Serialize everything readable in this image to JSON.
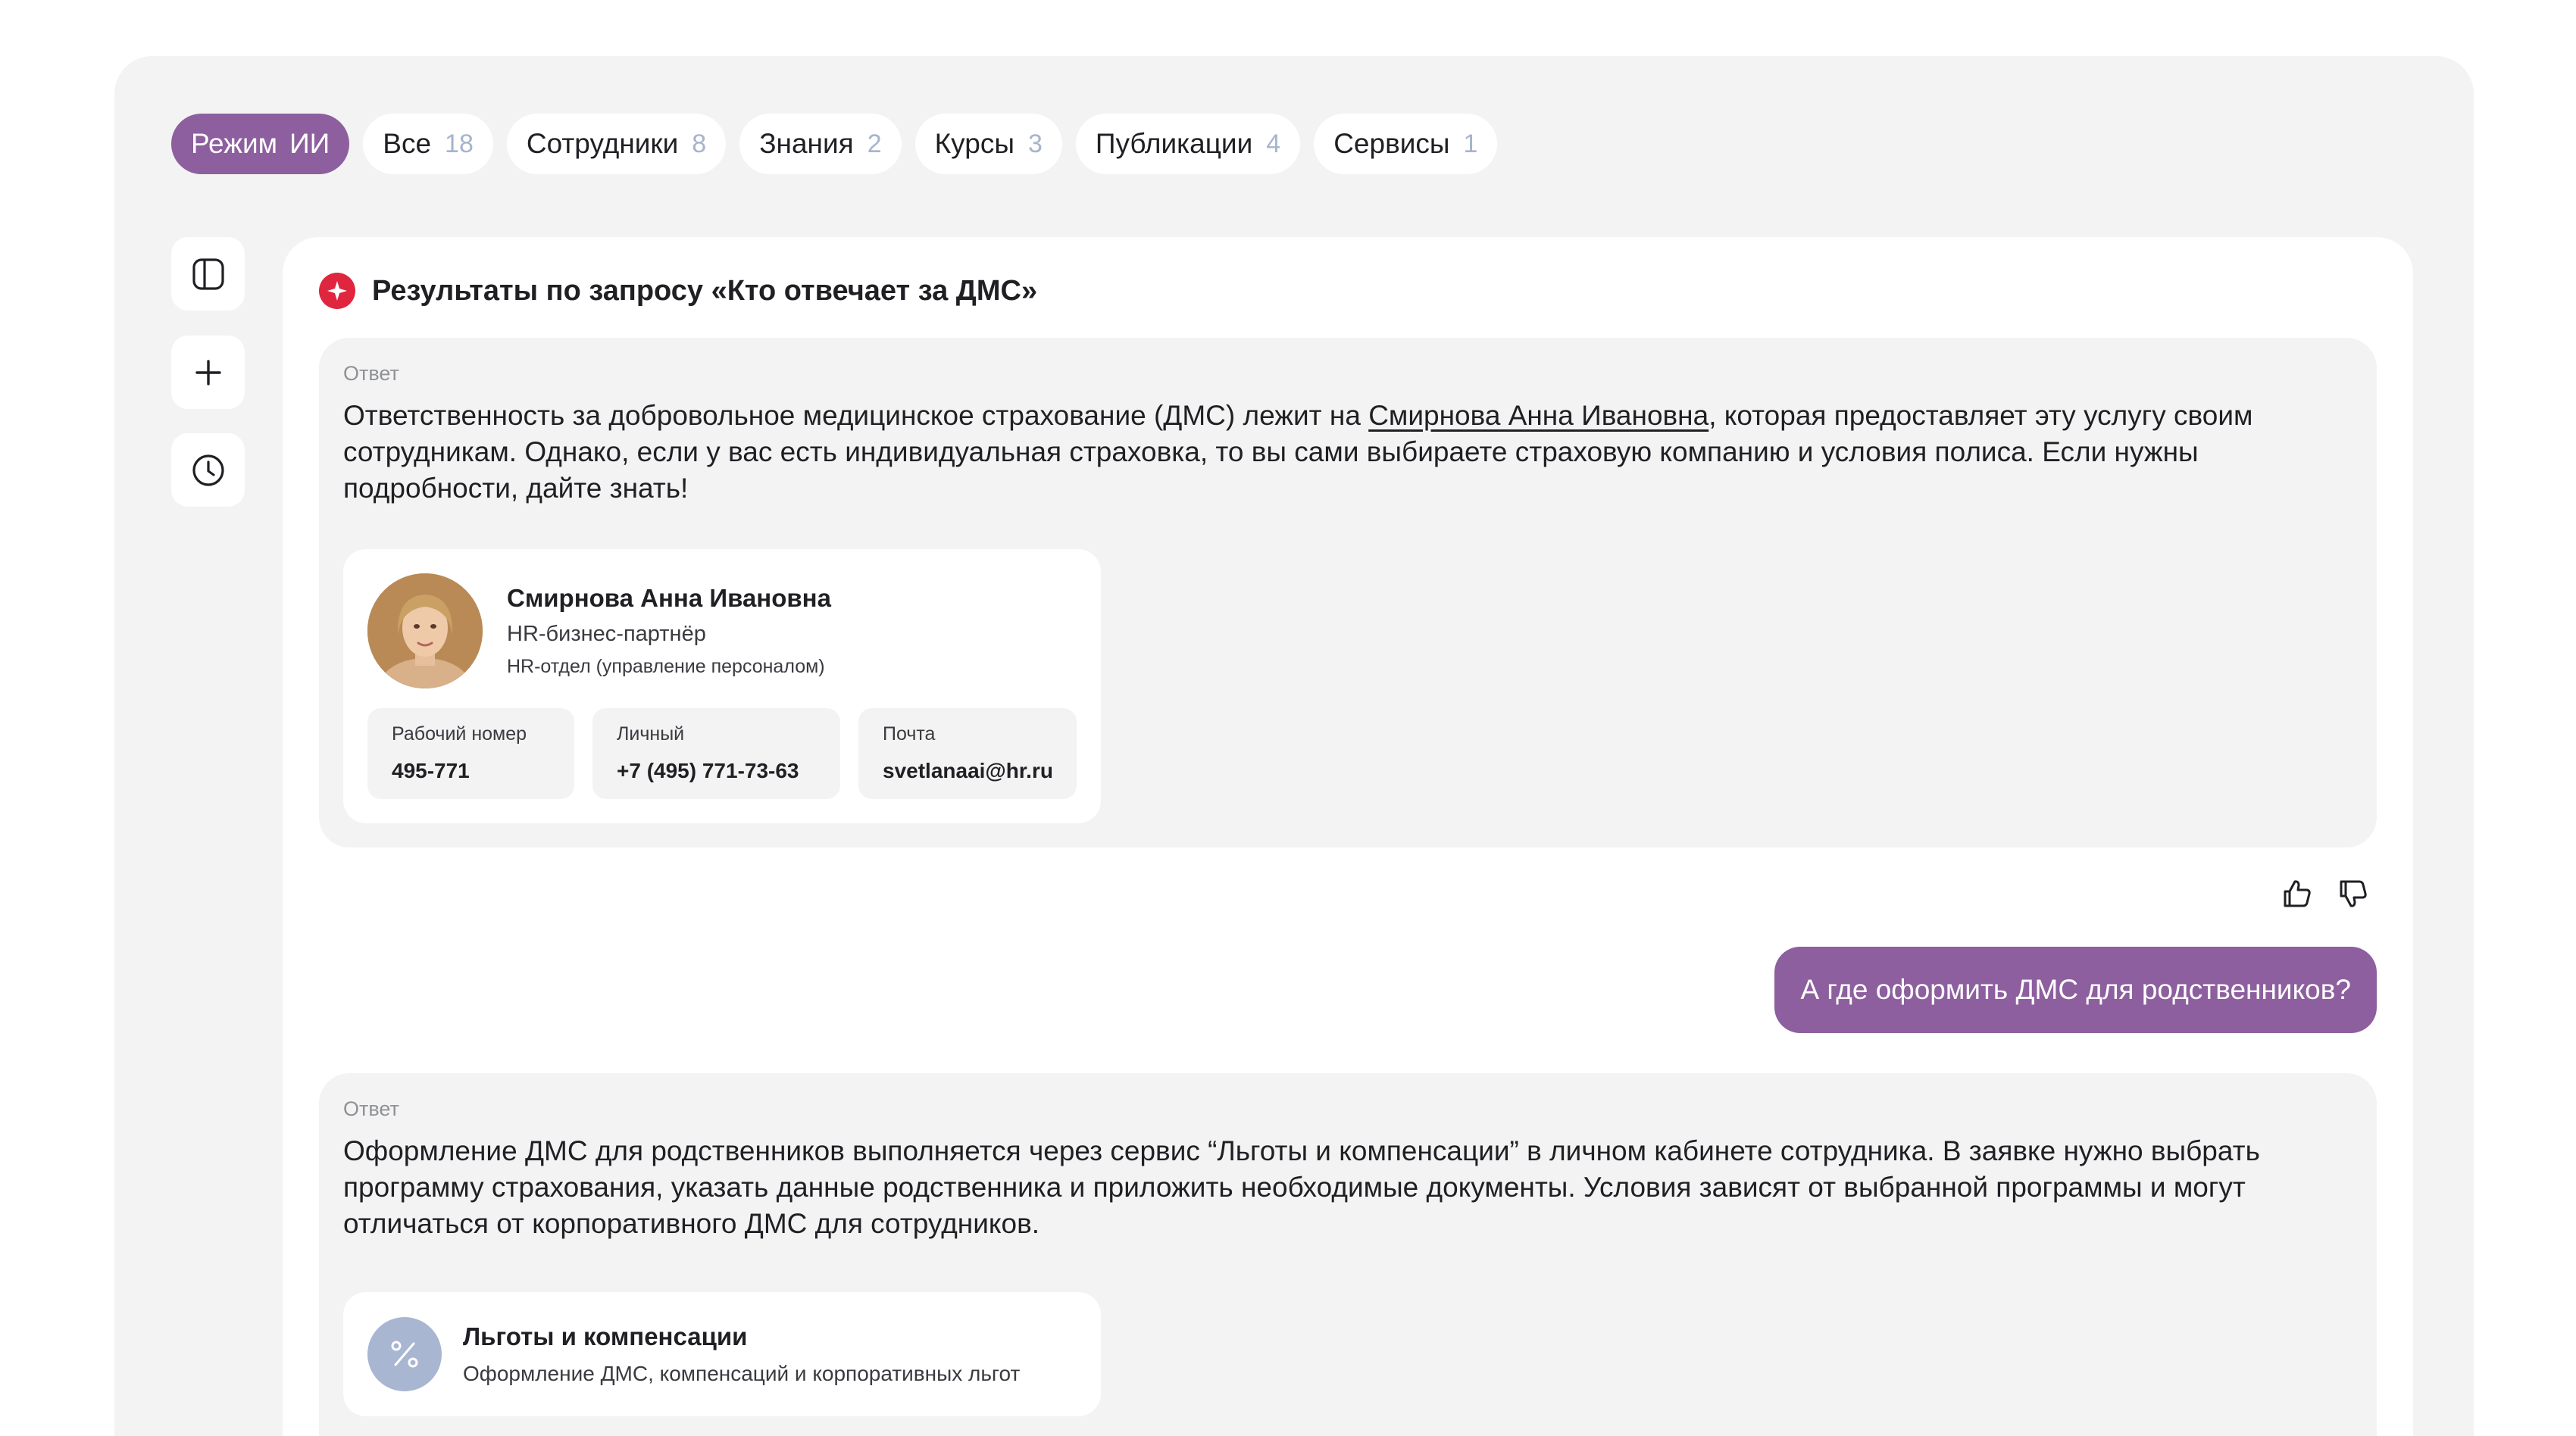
{
  "tabs": [
    {
      "label": "Режим",
      "count": "ИИ",
      "active": true
    },
    {
      "label": "Все",
      "count": "18"
    },
    {
      "label": "Сотрудники",
      "count": "8"
    },
    {
      "label": "Знания",
      "count": "2"
    },
    {
      "label": "Курсы",
      "count": "3"
    },
    {
      "label": "Публикации",
      "count": "4"
    },
    {
      "label": "Сервисы",
      "count": "1"
    }
  ],
  "sidebar": {
    "icons": [
      "sidebar-toggle-icon",
      "plus-icon",
      "history-clock-icon"
    ]
  },
  "results": {
    "title": "Результаты по запросу «Кто отвечает за ДМС»",
    "badge_color": "#e0263e"
  },
  "answer1": {
    "label": "Ответ",
    "text_before": "Ответственность за добровольное медицинское страхование (ДМС) лежит на ",
    "link": "Смирнова Анна Ивановна",
    "text_after": ", которая предоставляет эту услугу своим сотрудникам. Однако, если у вас есть индивидуальная страховка, то вы сами выбираете страховую компанию и условия полиса. Если нужны подробности, дайте знать!",
    "person": {
      "name": "Смирнова Анна Ивановна",
      "role": "HR-бизнес-партнёр",
      "department": "HR-отдел (управление персоналом)",
      "contacts": [
        {
          "label": "Рабочий номер",
          "value": "495-771"
        },
        {
          "label": "Личный",
          "value": "+7 (495) 771-73-63"
        },
        {
          "label": "Почта",
          "value": "svetlanaai@hr.ru"
        }
      ]
    }
  },
  "feedback": {
    "icons": [
      "thumbs-up-icon",
      "thumbs-down-icon"
    ]
  },
  "user_message": "А где оформить ДМС для родственников?",
  "answer2": {
    "label": "Ответ",
    "text": "Оформление ДМС для родственников выполняется через сервис “Льготы и компенсации” в личном кабинете сотрудника. В заявке нужно выбрать программу страхования, указать данные родственника и приложить необходимые документы. Условия зависят от выбранной программы и могут отличаться от корпоративного ДМС для сотрудников.",
    "service": {
      "name": "Льготы и компенсации",
      "description": "Оформление ДМС, компенсаций и корпоративных льгот",
      "icon": "percent-icon"
    }
  },
  "colors": {
    "accent": "#8d5f9e",
    "frame_bg": "#f3f3f3",
    "count_text": "#a6b4cc",
    "service_icon_bg": "#a9b6d1"
  }
}
